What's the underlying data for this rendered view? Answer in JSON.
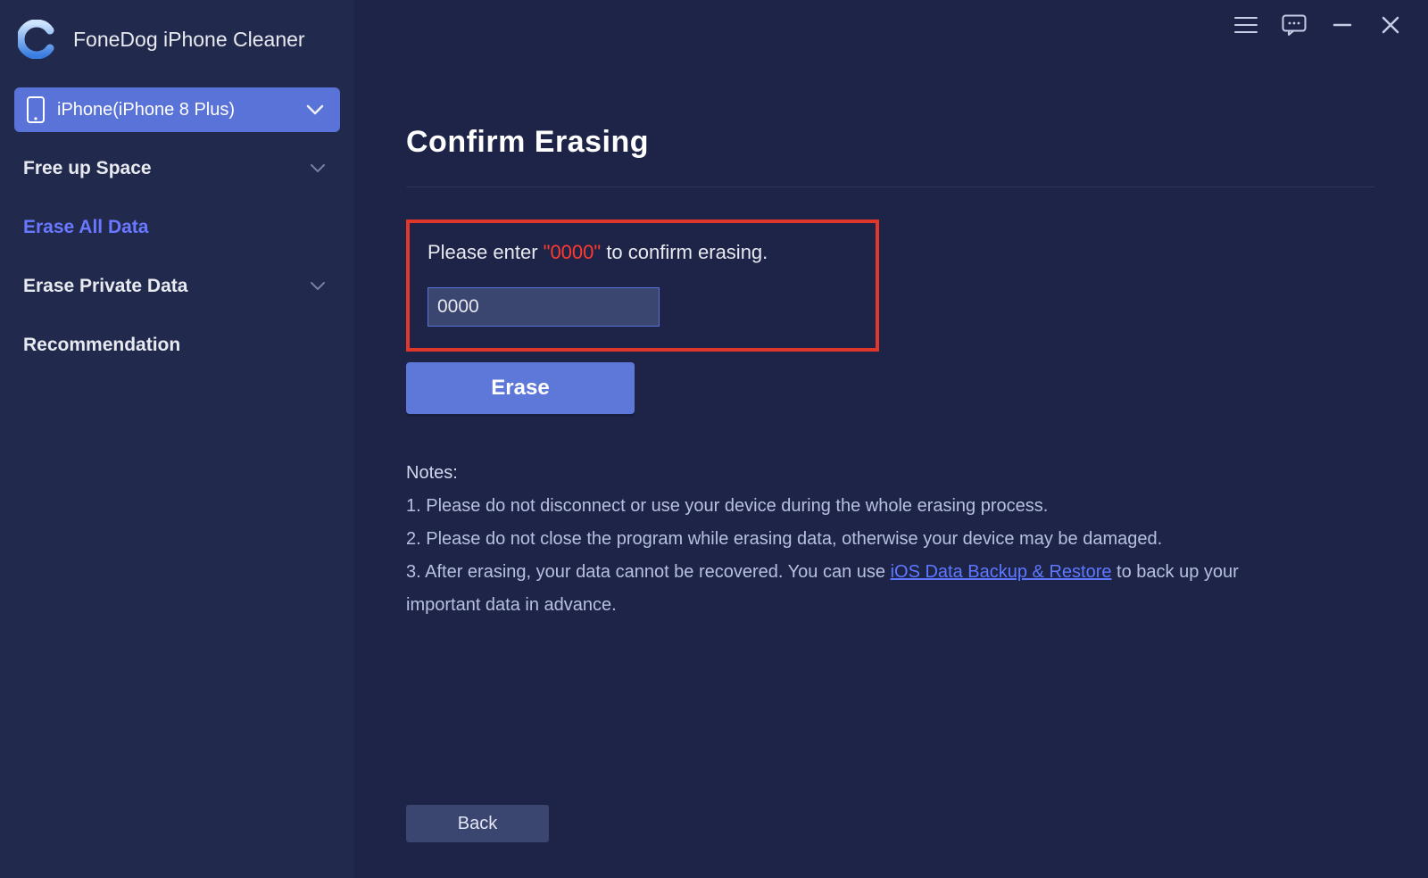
{
  "brand": {
    "title": "FoneDog iPhone Cleaner"
  },
  "device": {
    "name": "iPhone(iPhone 8 Plus)"
  },
  "nav": {
    "free_up_space": "Free up Space",
    "erase_all_data": "Erase All Data",
    "erase_private_data": "Erase Private Data",
    "recommendation": "Recommendation"
  },
  "main": {
    "heading": "Confirm Erasing",
    "confirm_prefix": "Please enter ",
    "confirm_code": "\"0000\"",
    "confirm_suffix": " to confirm erasing.",
    "input_value": "0000",
    "erase_btn": "Erase",
    "notes_heading": "Notes:",
    "note1": "1. Please do not disconnect or use your device during the whole erasing process.",
    "note2": "2. Please do not close the program while erasing data, otherwise your device may be damaged.",
    "note3_prefix": "3. After erasing, your data cannot be recovered. You can use ",
    "note3_link": "iOS Data Backup & Restore",
    "note3_suffix": " to back up your important data in advance.",
    "back_btn": "Back"
  }
}
